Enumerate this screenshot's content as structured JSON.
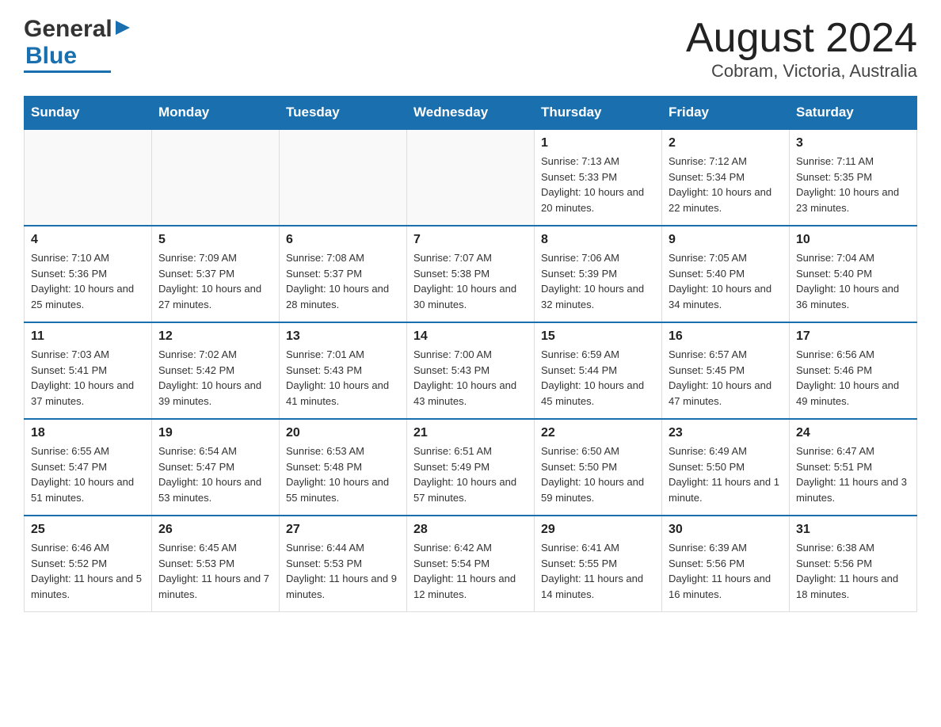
{
  "header": {
    "logo_general": "General",
    "logo_blue": "Blue",
    "title": "August 2024",
    "subtitle": "Cobram, Victoria, Australia"
  },
  "calendar": {
    "days": [
      "Sunday",
      "Monday",
      "Tuesday",
      "Wednesday",
      "Thursday",
      "Friday",
      "Saturday"
    ],
    "weeks": [
      [
        {
          "day": "",
          "info": ""
        },
        {
          "day": "",
          "info": ""
        },
        {
          "day": "",
          "info": ""
        },
        {
          "day": "",
          "info": ""
        },
        {
          "day": "1",
          "info": "Sunrise: 7:13 AM\nSunset: 5:33 PM\nDaylight: 10 hours and 20 minutes."
        },
        {
          "day": "2",
          "info": "Sunrise: 7:12 AM\nSunset: 5:34 PM\nDaylight: 10 hours and 22 minutes."
        },
        {
          "day": "3",
          "info": "Sunrise: 7:11 AM\nSunset: 5:35 PM\nDaylight: 10 hours and 23 minutes."
        }
      ],
      [
        {
          "day": "4",
          "info": "Sunrise: 7:10 AM\nSunset: 5:36 PM\nDaylight: 10 hours and 25 minutes."
        },
        {
          "day": "5",
          "info": "Sunrise: 7:09 AM\nSunset: 5:37 PM\nDaylight: 10 hours and 27 minutes."
        },
        {
          "day": "6",
          "info": "Sunrise: 7:08 AM\nSunset: 5:37 PM\nDaylight: 10 hours and 28 minutes."
        },
        {
          "day": "7",
          "info": "Sunrise: 7:07 AM\nSunset: 5:38 PM\nDaylight: 10 hours and 30 minutes."
        },
        {
          "day": "8",
          "info": "Sunrise: 7:06 AM\nSunset: 5:39 PM\nDaylight: 10 hours and 32 minutes."
        },
        {
          "day": "9",
          "info": "Sunrise: 7:05 AM\nSunset: 5:40 PM\nDaylight: 10 hours and 34 minutes."
        },
        {
          "day": "10",
          "info": "Sunrise: 7:04 AM\nSunset: 5:40 PM\nDaylight: 10 hours and 36 minutes."
        }
      ],
      [
        {
          "day": "11",
          "info": "Sunrise: 7:03 AM\nSunset: 5:41 PM\nDaylight: 10 hours and 37 minutes."
        },
        {
          "day": "12",
          "info": "Sunrise: 7:02 AM\nSunset: 5:42 PM\nDaylight: 10 hours and 39 minutes."
        },
        {
          "day": "13",
          "info": "Sunrise: 7:01 AM\nSunset: 5:43 PM\nDaylight: 10 hours and 41 minutes."
        },
        {
          "day": "14",
          "info": "Sunrise: 7:00 AM\nSunset: 5:43 PM\nDaylight: 10 hours and 43 minutes."
        },
        {
          "day": "15",
          "info": "Sunrise: 6:59 AM\nSunset: 5:44 PM\nDaylight: 10 hours and 45 minutes."
        },
        {
          "day": "16",
          "info": "Sunrise: 6:57 AM\nSunset: 5:45 PM\nDaylight: 10 hours and 47 minutes."
        },
        {
          "day": "17",
          "info": "Sunrise: 6:56 AM\nSunset: 5:46 PM\nDaylight: 10 hours and 49 minutes."
        }
      ],
      [
        {
          "day": "18",
          "info": "Sunrise: 6:55 AM\nSunset: 5:47 PM\nDaylight: 10 hours and 51 minutes."
        },
        {
          "day": "19",
          "info": "Sunrise: 6:54 AM\nSunset: 5:47 PM\nDaylight: 10 hours and 53 minutes."
        },
        {
          "day": "20",
          "info": "Sunrise: 6:53 AM\nSunset: 5:48 PM\nDaylight: 10 hours and 55 minutes."
        },
        {
          "day": "21",
          "info": "Sunrise: 6:51 AM\nSunset: 5:49 PM\nDaylight: 10 hours and 57 minutes."
        },
        {
          "day": "22",
          "info": "Sunrise: 6:50 AM\nSunset: 5:50 PM\nDaylight: 10 hours and 59 minutes."
        },
        {
          "day": "23",
          "info": "Sunrise: 6:49 AM\nSunset: 5:50 PM\nDaylight: 11 hours and 1 minute."
        },
        {
          "day": "24",
          "info": "Sunrise: 6:47 AM\nSunset: 5:51 PM\nDaylight: 11 hours and 3 minutes."
        }
      ],
      [
        {
          "day": "25",
          "info": "Sunrise: 6:46 AM\nSunset: 5:52 PM\nDaylight: 11 hours and 5 minutes."
        },
        {
          "day": "26",
          "info": "Sunrise: 6:45 AM\nSunset: 5:53 PM\nDaylight: 11 hours and 7 minutes."
        },
        {
          "day": "27",
          "info": "Sunrise: 6:44 AM\nSunset: 5:53 PM\nDaylight: 11 hours and 9 minutes."
        },
        {
          "day": "28",
          "info": "Sunrise: 6:42 AM\nSunset: 5:54 PM\nDaylight: 11 hours and 12 minutes."
        },
        {
          "day": "29",
          "info": "Sunrise: 6:41 AM\nSunset: 5:55 PM\nDaylight: 11 hours and 14 minutes."
        },
        {
          "day": "30",
          "info": "Sunrise: 6:39 AM\nSunset: 5:56 PM\nDaylight: 11 hours and 16 minutes."
        },
        {
          "day": "31",
          "info": "Sunrise: 6:38 AM\nSunset: 5:56 PM\nDaylight: 11 hours and 18 minutes."
        }
      ]
    ]
  }
}
